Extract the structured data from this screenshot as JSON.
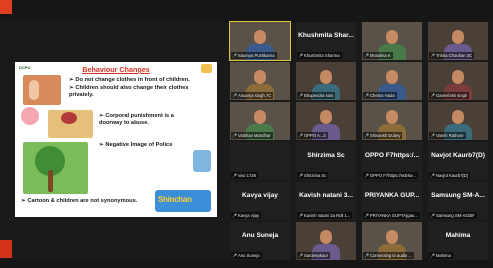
{
  "slide": {
    "title": "Behaviour Changes",
    "bullets": [
      "Do not change clothes in front of children.",
      "Children should also change their clothes privately.",
      "Corporal punishment is a doorway to abuse.",
      "Negative Image of Police",
      "Cartoon & children are not synonymous."
    ],
    "cartoon_logo": "Shinchan",
    "logo_left": "DCPU"
  },
  "participants": [
    {
      "label": "Saumya Pushkarna",
      "big": "",
      "video": true,
      "self": true
    },
    {
      "label": "Khushmita Sharma",
      "big": "Khushmita Shar...",
      "video": false
    },
    {
      "label": "Monalisa K",
      "big": "",
      "video": true
    },
    {
      "label": "Trisha Chouhan 3C",
      "big": "",
      "video": true
    },
    {
      "label": "Anuarya singh 7C",
      "big": "",
      "video": true
    },
    {
      "label": "Bhupendra soni",
      "big": "",
      "video": true
    },
    {
      "label": "Chetna Hada",
      "big": "",
      "video": true
    },
    {
      "label": "Ganeshish singh",
      "big": "",
      "video": true
    },
    {
      "label": "Vaibhav Mandhar",
      "big": "",
      "video": true
    },
    {
      "label": "OPPO A...3",
      "big": "",
      "video": true
    },
    {
      "label": "Shivansh Dubey",
      "big": "",
      "video": true
    },
    {
      "label": "Vansh Rathore",
      "big": "",
      "video": true
    },
    {
      "label": "vivo 1726",
      "big": "",
      "video": false
    },
    {
      "label": "Shirzima Sc",
      "big": "Shirzima Sc",
      "video": false
    },
    {
      "label": "OPPO F7https://ss04w...",
      "big": "OPPO F7https:/...",
      "video": false
    },
    {
      "label": "Navjot Kaurb7[D]",
      "big": "Navjot Kaurb7(D)",
      "video": false
    },
    {
      "label": "Kavya vijay",
      "big": "Kavya vijay",
      "video": false
    },
    {
      "label": "Kavish natani 3a Roll 1...",
      "big": "Kavish natani 3...",
      "video": false
    },
    {
      "label": "PRIYANKA GUPTA(gau...",
      "big": "PRIYANKA GUP...",
      "video": false
    },
    {
      "label": "Samsung SM-A325F",
      "big": "Samsung SM-A...",
      "video": false
    },
    {
      "label": "Anu Suneja",
      "big": "Anu Suneja",
      "video": false
    },
    {
      "label": "Sardeepkaur",
      "big": "",
      "video": true
    },
    {
      "label": "Connecting to audio ...",
      "big": "",
      "video": true
    },
    {
      "label": "Mahima",
      "big": "Mahima",
      "video": false
    }
  ],
  "colors": {
    "accent": "#e0401f",
    "background": "#1a1a1a",
    "tile": "#202020",
    "selected_outline": "#d9c83a",
    "muted_mic": "#e84a3a"
  }
}
